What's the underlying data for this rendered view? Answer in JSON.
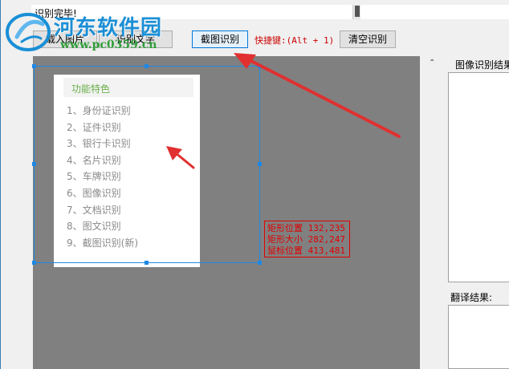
{
  "window": {
    "title": "识别完毕!"
  },
  "watermark": {
    "name": "河东软件园",
    "url": "www.pc0359.cn"
  },
  "toolbar": {
    "load_label": "载入图片",
    "recognize_label": "识别文字",
    "screenshot_label": "截图识别",
    "hotkey_text": "快捷键:(Alt + 1)",
    "clear_label": "清空识别"
  },
  "preview_card": {
    "title": "功能特色",
    "features": [
      "1、身份证识别",
      "2、证件识别",
      "3、银行卡识别",
      "4、名片识别",
      "5、车牌识别",
      "6、图像识别",
      "7、文档识别",
      "8、图文识别",
      "9、截图识别(新)"
    ]
  },
  "selection_info": {
    "position": "矩形位置 132,235",
    "size": "矩形大小 282,247",
    "mouse": "鼠标位置 413,481"
  },
  "right_pane": {
    "collapse_icon": "chevron-up-icon",
    "result_label": "图像识别结果",
    "translate_label": "翻译结果:"
  },
  "colors": {
    "accent_blue": "#1e88e5",
    "arrow_red": "#e03030",
    "hotkey_red": "#cc0000",
    "panel_gray": "#808080"
  }
}
